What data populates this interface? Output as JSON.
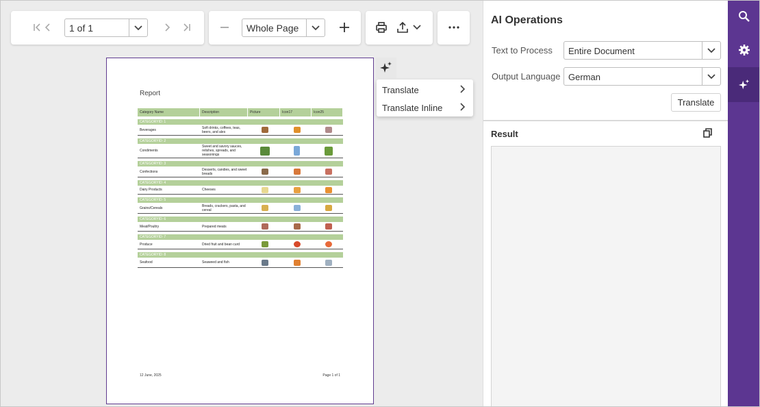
{
  "toolbar": {
    "page_indicator": "1 of 1",
    "zoom_value": "Whole Page"
  },
  "document": {
    "title": "Report",
    "columns": [
      "Category Name",
      "Description",
      "Picture",
      "Icon17",
      "Icon25"
    ],
    "groups": [
      {
        "label": "CATEGORYID: 1",
        "name": "Beverages",
        "description": "Soft drinks, coffees, teas, beers, and ales"
      },
      {
        "label": "CATEGORYID: 2",
        "name": "Condiments",
        "description": "Sweet and savory sauces, relishes, spreads, and seasonings"
      },
      {
        "label": "CATEGORYID: 3",
        "name": "Confections",
        "description": "Desserts, candies, and sweet breads"
      },
      {
        "label": "CATEGORYID: 4",
        "name": "Dairy Products",
        "description": "Cheeses"
      },
      {
        "label": "CATEGORYID: 5",
        "name": "Grains/Cereals",
        "description": "Breads, crackers, pasta, and cereal"
      },
      {
        "label": "CATEGORYID: 6",
        "name": "Meat/Poultry",
        "description": "Prepared meats"
      },
      {
        "label": "CATEGORYID: 7",
        "name": "Produce",
        "description": "Dried fruit and bean curd"
      },
      {
        "label": "CATEGORYID: 8",
        "name": "Seafood",
        "description": "Seaweed and fish"
      }
    ],
    "footer_date": "12 June, 2025",
    "footer_page": "Page 1 of 1"
  },
  "ai_menu": {
    "items": [
      {
        "label": "Translate"
      },
      {
        "label": "Translate Inline"
      }
    ]
  },
  "panel": {
    "title": "AI Operations",
    "text_to_process_label": "Text to Process",
    "text_to_process_value": "Entire Document",
    "output_language_label": "Output Language",
    "output_language_value": "German",
    "translate_button": "Translate",
    "result_label": "Result",
    "result_text": ""
  },
  "colors": {
    "accent": "#5c3691",
    "accent_active": "#4a2a79",
    "report_header": "#b4d09a"
  },
  "icons": [
    "first-page-icon",
    "prev-page-icon",
    "next-page-icon",
    "last-page-icon",
    "zoom-out-icon",
    "zoom-in-icon",
    "print-icon",
    "export-icon",
    "more-icon",
    "sparkle-icon",
    "search-icon",
    "gear-icon",
    "copy-icon"
  ]
}
